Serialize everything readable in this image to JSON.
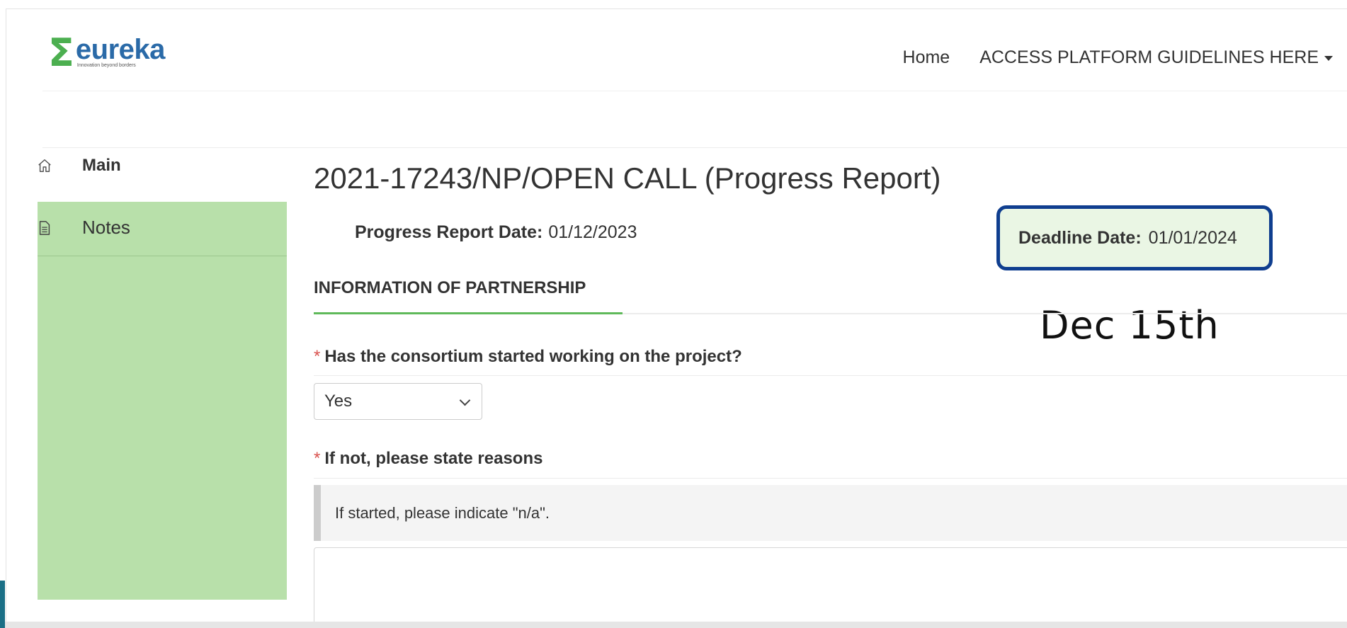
{
  "header": {
    "logo_word": "eureka",
    "logo_tagline": "Innovation beyond borders",
    "nav": {
      "home": "Home",
      "guidelines": "ACCESS PLATFORM GUIDELINES HERE"
    }
  },
  "sidebar": {
    "items": [
      {
        "label": "Main",
        "icon": "home-icon"
      },
      {
        "label": "Notes",
        "icon": "document-icon"
      }
    ]
  },
  "main": {
    "title": "2021-17243/NP/OPEN CALL (Progress Report)",
    "report_date_label": "Progress Report Date:",
    "report_date_value": "01/12/2023",
    "deadline_label": "Deadline Date:",
    "deadline_value": "01/01/2024",
    "annotation": "Dec 15th",
    "tab": "INFORMATION OF PARTNERSHIP",
    "q1": {
      "required_mark": "*",
      "label": "Has the consortium started working on the project?",
      "value": "Yes"
    },
    "q2": {
      "required_mark": "*",
      "label": "If not, please state reasons",
      "hint": "If started, please indicate \"n/a\"."
    }
  },
  "colors": {
    "brand_green": "#4caf50",
    "brand_blue": "#2a6aa8",
    "sidebar_active": "#b8e0aa",
    "highlight_border": "#0f3e8f",
    "required": "#d9534f"
  }
}
